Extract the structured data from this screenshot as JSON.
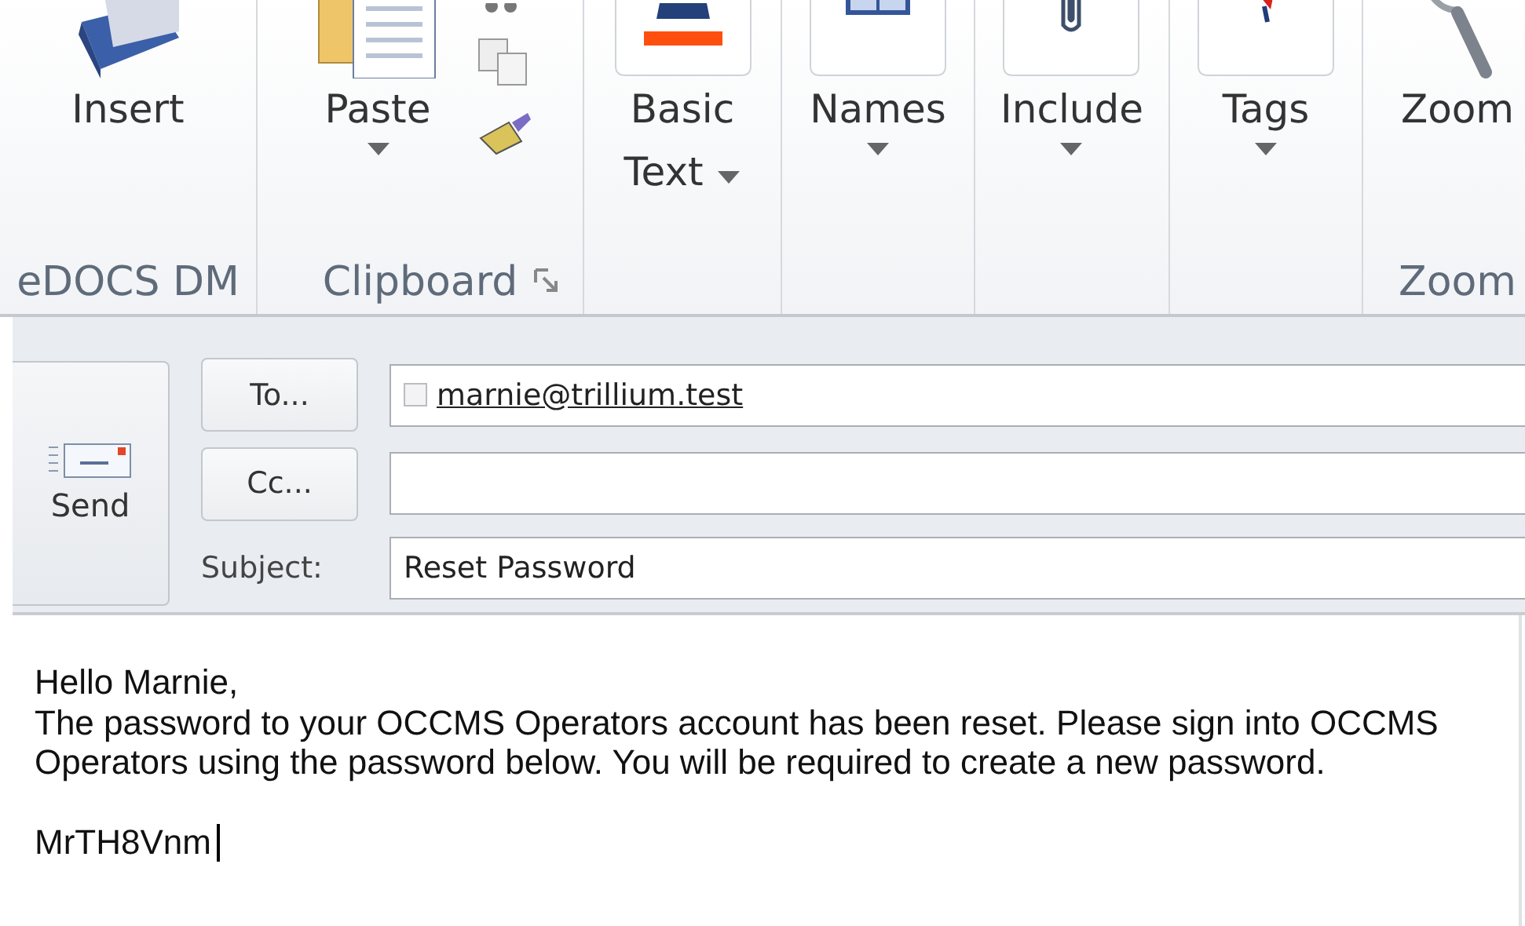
{
  "ribbon": {
    "groups": [
      {
        "label": "eDOCS DM",
        "kind": "plain",
        "buttons": [
          {
            "label": "Insert",
            "kind": "plain"
          }
        ]
      },
      {
        "label": "Clipboard",
        "kind": "clipboard",
        "buttons": [
          {
            "label": "Paste",
            "kind": "split"
          }
        ]
      },
      {
        "kind": "plain",
        "buttons": [
          {
            "label": "Basic Text",
            "kind": "inline"
          }
        ]
      },
      {
        "kind": "plain",
        "buttons": [
          {
            "label": "Names",
            "kind": "split"
          }
        ]
      },
      {
        "kind": "plain",
        "buttons": [
          {
            "label": "Include",
            "kind": "split"
          }
        ]
      },
      {
        "kind": "plain",
        "buttons": [
          {
            "label": "Tags",
            "kind": "split"
          }
        ]
      },
      {
        "label": "Zoom",
        "kind": "plain",
        "buttons": [
          {
            "label": "Zoom",
            "kind": "plain"
          }
        ]
      }
    ]
  },
  "compose": {
    "send": "Send",
    "to_button": "To...",
    "cc_button": "Cc...",
    "subject_label": "Subject:",
    "recipients": [
      {
        "address": "marnie@trillium.test",
        "checked": false
      }
    ],
    "subject": "Reset Password"
  },
  "body": {
    "greeting": "Hello Marnie,",
    "paragraph": "The password to your OCCMS Operators account has been reset. Please sign into OCCMS Operators using the password below. You will be required to create a new password.",
    "password": "MrTH8Vnm"
  }
}
